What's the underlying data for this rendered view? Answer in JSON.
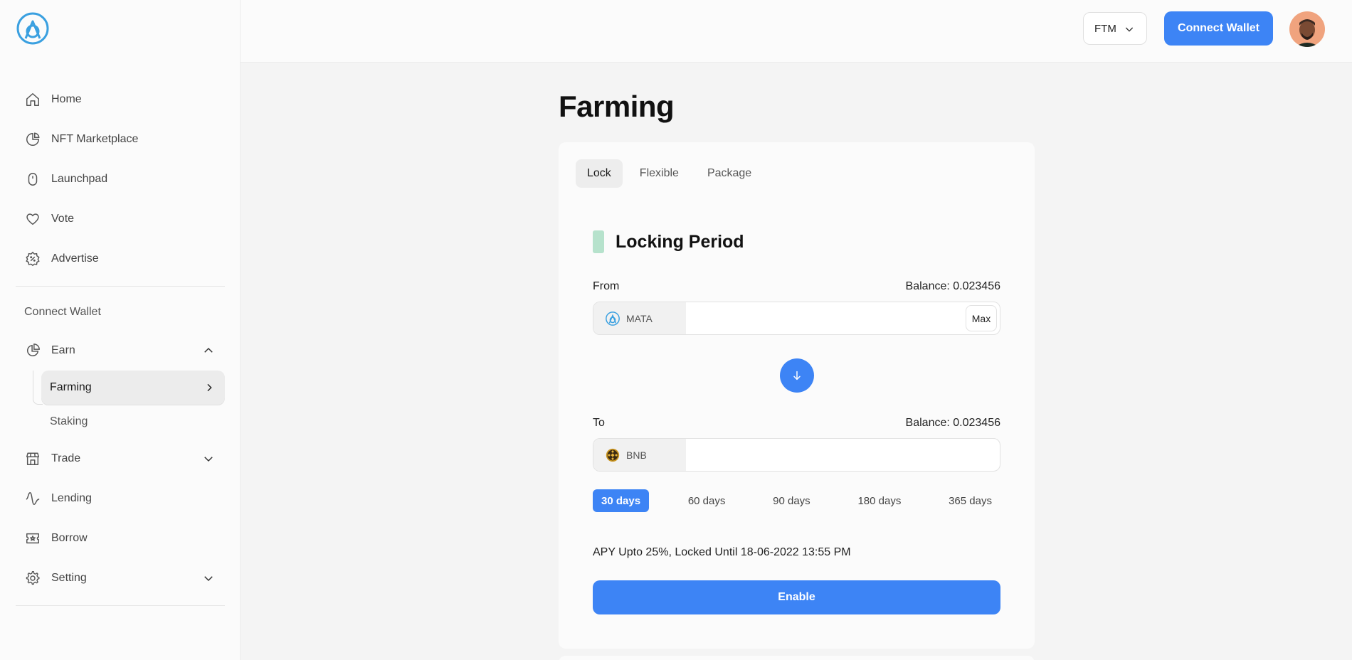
{
  "header": {
    "network": "FTM",
    "connect_label": "Connect Wallet"
  },
  "sidebar": {
    "items": [
      {
        "label": "Home",
        "icon": "home-icon"
      },
      {
        "label": "NFT Marketplace",
        "icon": "pie-chart-icon"
      },
      {
        "label": "Launchpad",
        "icon": "mouse-icon"
      },
      {
        "label": "Vote",
        "icon": "heart-icon"
      },
      {
        "label": "Advertise",
        "icon": "discount-badge-icon"
      }
    ],
    "section_label": "Connect Wallet",
    "earn": {
      "label": "Earn",
      "sub": [
        {
          "label": "Farming",
          "active": true
        },
        {
          "label": "Staking"
        }
      ]
    },
    "items2": [
      {
        "label": "Trade",
        "icon": "store-icon"
      },
      {
        "label": "Lending",
        "icon": "activity-icon"
      },
      {
        "label": "Borrow",
        "icon": "ticket-icon"
      },
      {
        "label": "Setting",
        "icon": "gear-icon"
      }
    ]
  },
  "main": {
    "title": "Farming",
    "tabs": [
      "Lock",
      "Flexible",
      "Package"
    ],
    "active_tab": "Lock",
    "section_title": "Locking Period",
    "from": {
      "label": "From",
      "balance": "Balance: 0.023456",
      "token": "MATA",
      "max_label": "Max",
      "amount": ""
    },
    "to": {
      "label": "To",
      "balance": "Balance: 0.023456",
      "token": "BNB",
      "amount": ""
    },
    "periods": [
      "30 days",
      "60 days",
      "90 days",
      "180 days",
      "365 days"
    ],
    "active_period": "30 days",
    "apy_text": "APY Upto 25%, Locked Until 18-06-2022 13:55 PM",
    "enable_label": "Enable"
  },
  "colors": {
    "accent": "#3d84f5",
    "marker": "#b6e2cc",
    "logo": "#3aa0e0",
    "bnb": "#c9941f"
  }
}
